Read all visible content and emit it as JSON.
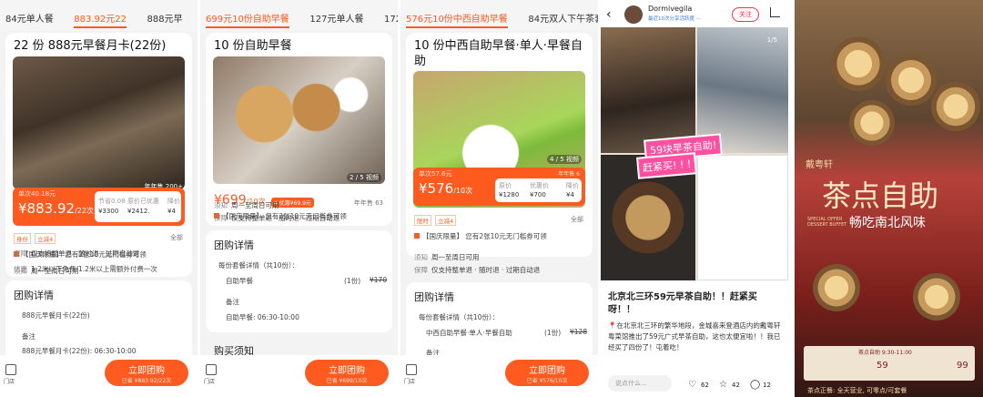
{
  "panel1": {
    "tabs": [
      "84元单人餐",
      "883.92元22",
      "888元早"
    ],
    "title": "22 份 888元早餐月卡(22份)",
    "stock": "年年售 200+",
    "price_tag": "单次40.18元",
    "price": "883.92",
    "price_unit": "/22次",
    "save_label": "节省0.08",
    "value_label": "原价已优惠",
    "ratio_label": "降价",
    "v1": "¥3300",
    "v2": "¥2412.",
    "v3": "¥4",
    "tags": [
      "身份",
      "立减4"
    ],
    "all": "全部",
    "coupon": "【国庆限量】 您有2张10元无门槛券可领",
    "rows": [
      [
        "须知",
        "周一至周日可用"
      ],
      [
        "保障",
        "仅支持整单退  · 随时退 · 过期自动退"
      ],
      [
        "优惠",
        "1.2米以下免费/1.2米以上需额外付费一次"
      ]
    ],
    "section": "团购详情",
    "detail1": "888元早餐月卡(22份)",
    "detail2": "备注",
    "detail3": "888元早餐月卡(22份): 06:30-10:00",
    "store": "门店",
    "buy": "立即团购",
    "buy_sub": "已省 ¥883.92/22次"
  },
  "panel2": {
    "tabs": [
      "699元10份自助早餐",
      "127元单人餐",
      "172元"
    ],
    "title": "10 份自助早餐",
    "img_count": "2 / 5 视频",
    "price": "699",
    "price_unit": "/10次",
    "badge": "4 优惠¥69.9元",
    "sold": "年年售 63",
    "coupon": "【国庆限量】 您有2张10元无门槛券可领",
    "rows": [
      [
        "须知",
        "周一至周日可用"
      ],
      [
        "保障",
        "仅支持整单退  · 随时退 · 过期自动退"
      ]
    ],
    "section": "团购详情",
    "detail_head": "每份套餐详情（共10份）：",
    "detail_item": "自助早餐",
    "detail_qty": "(1份)",
    "detail_price": "¥170",
    "note": "备注",
    "note_text": "自助早餐: 06:30-10:00",
    "section2": "购买须知",
    "store": "门店",
    "buy": "立即团购",
    "buy_sub": "已省 ¥699/10次"
  },
  "panel3": {
    "tabs": [
      "576元10份中西自助早餐",
      "84元双人下午茶套"
    ],
    "title": "10 份中西自助早餐·单人·早餐自助",
    "img_count": "4 / 5 视频",
    "price_tag": "单次57.6元",
    "stock": "年年售 6",
    "price": "576",
    "price_unit": "/10次",
    "v1": "¥1280",
    "v2": "¥700",
    "v3": "¥4",
    "v_labels": [
      "原价",
      "优惠价",
      "降价"
    ],
    "tags": [
      "限时",
      "立减4"
    ],
    "all": "全部",
    "coupon": "【国庆限量】 您有2张10元无门槛券可领",
    "rows": [
      [
        "须知",
        "周一至周日可用"
      ],
      [
        "保障",
        "仅支持整单退  · 随时退 · 过期自动退"
      ]
    ],
    "section": "团购详情",
    "detail_head": "每份套餐详情（共10份）：",
    "detail_item": "中西自助早餐·单人·早餐自助",
    "detail_qty": "(1份)",
    "detail_price": "¥128",
    "note": "备注",
    "store": "门店",
    "buy": "立即团购",
    "buy_sub": "已省 ¥576/10次"
  },
  "xhs": {
    "user": "Dormivegila",
    "user_sub": "最近10次分享活跃度 ··· ",
    "follow": "关注",
    "img_count": "1/5",
    "sticker1": "59块早茶自助!",
    "sticker2": "赶紧买! ! !",
    "title": "北京北三环59元早茶自助！！赶紧买呀！！",
    "body": "📍在北京北三环的繁华地段，金城喜来登酒店内的戴粤轩 粤菜馆推出了59元广式早茶自助，这也太便宜啦！！我已经买了四份了！屯着吃！",
    "link": "金城喜来登酒店",
    "input": "说点什么...",
    "likes": "62",
    "stars": "42",
    "comments": "12"
  },
  "poster": {
    "brand": "戴粤轩",
    "title": "茶点自助",
    "subtitle": "畅吃南北风味",
    "en": "SPECIAL OFFER DESSERT BUFFET",
    "time": "茶点自助 9:30-11:00",
    "p1": "59",
    "p2": "99",
    "footer": "茶点正餐: 全天营业, 可零点/可套餐"
  }
}
